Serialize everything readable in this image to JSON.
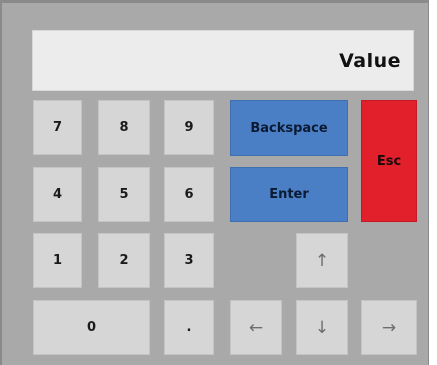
{
  "display": {
    "value": "Value"
  },
  "keys": {
    "k7": "7",
    "k8": "8",
    "k9": "9",
    "k4": "4",
    "k5": "5",
    "k6": "6",
    "k1": "1",
    "k2": "2",
    "k3": "3",
    "k0": "0",
    "dot": ".",
    "backspace": "Backspace",
    "enter": "Enter",
    "esc": "Esc",
    "up": "↑",
    "left": "←",
    "down": "↓",
    "right": "→"
  },
  "colors": {
    "panel": "#a9a9a9",
    "key": "#d6d6d6",
    "blue": "#4a7fc5",
    "red": "#e2202c",
    "display": "#ececec"
  },
  "icons": {
    "up": "arrow-up-icon",
    "left": "arrow-left-icon",
    "down": "arrow-down-icon",
    "right": "arrow-right-icon"
  }
}
